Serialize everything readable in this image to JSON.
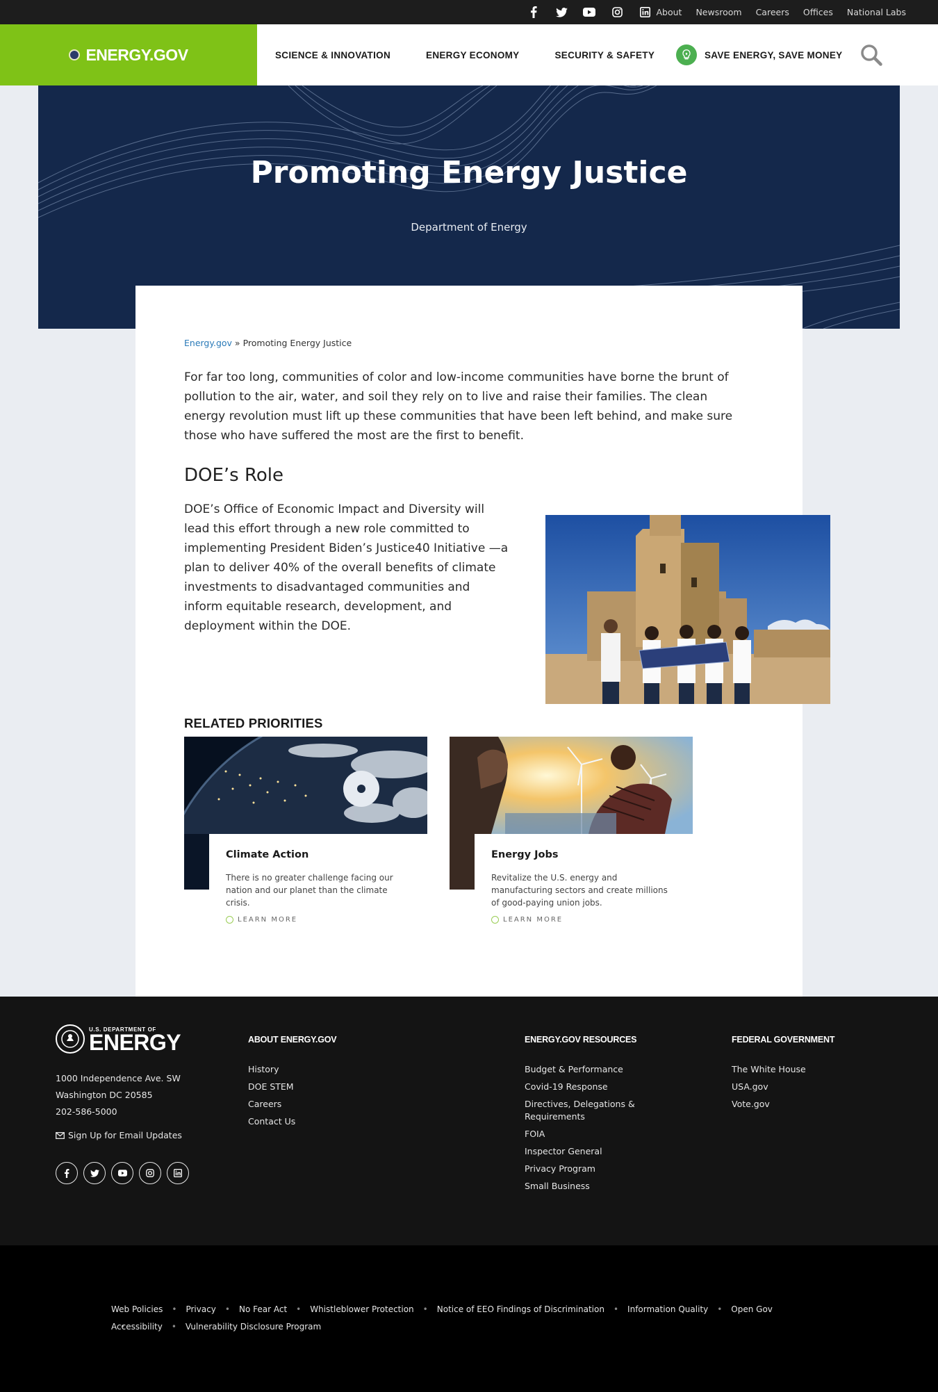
{
  "utility": {
    "social_icons": [
      "facebook-icon",
      "twitter-icon",
      "youtube-icon",
      "instagram-icon",
      "linkedin-icon"
    ],
    "links": [
      "About",
      "Newsroom",
      "Careers",
      "Offices",
      "National Labs"
    ]
  },
  "header": {
    "logo": "ENERGY.GOV",
    "nav": [
      "SCIENCE & INNOVATION",
      "ENERGY ECONOMY",
      "SECURITY & SAFETY"
    ],
    "save_energy": "SAVE ENERGY, SAVE MONEY",
    "search_icon": "search-icon",
    "brand_color": "#7fc217"
  },
  "hero": {
    "title": "Promoting Energy Justice",
    "subtitle": "Department of Energy",
    "background_color": "#14284b"
  },
  "main": {
    "breadcrumb": {
      "home": "Energy.gov",
      "separator": "»",
      "current": "Promoting Energy Justice"
    },
    "intro": "For far too long, communities of color and low-income communities have borne the brunt of pollution to the air, water, and soil they rely on to live and raise their families. The clean energy revolution must lift up these communities that have been left behind, and make sure those who have suffered the most are the first to benefit.",
    "role_heading": "DOE’s Role",
    "role_text": "DOE’s Office of Economic Impact and Diversity will lead this effort through a new role committed to  implementing President Biden’s Justice40 Initiative —a plan to deliver 40% of the overall benefits of climate investments to disadvantaged communities and inform equitable research, development, and deployment  within the DOE.",
    "related_heading": "RELATED PRIORITIES",
    "priorities": [
      {
        "title": "Climate Action",
        "text": "There is no greater challenge facing our nation and our planet than the climate crisis.",
        "link": "LEARN MORE"
      },
      {
        "title": "Energy Jobs",
        "text": "Revitalize the U.S. energy and manufacturing sectors and create millions of good-paying union jobs.",
        "link": "LEARN MORE"
      }
    ]
  },
  "footer": {
    "logo_small": "U.S. DEPARTMENT OF",
    "logo_big": "ENERGY",
    "address": [
      "1000 Independence Ave. SW",
      "Washington DC 20585",
      "202-586-5000"
    ],
    "email_signup": "Sign Up for Email Updates",
    "columns": [
      {
        "heading": "ABOUT ENERGY.GOV",
        "links": [
          "History",
          "DOE STEM",
          "Careers",
          "Contact Us"
        ]
      },
      {
        "heading": "ENERGY.GOV RESOURCES",
        "links": [
          "Budget & Performance",
          "Covid-19 Response",
          "Directives, Delegations & Requirements",
          "FOIA",
          "Inspector General",
          "Privacy Program",
          "Small Business"
        ]
      },
      {
        "heading": "FEDERAL GOVERNMENT",
        "links": [
          "The White House",
          "USA.gov",
          "Vote.gov"
        ]
      }
    ]
  },
  "legal": {
    "row1": [
      "Web Policies",
      "Privacy",
      "No Fear Act",
      "Whistleblower Protection",
      "Notice of EEO Findings of Discrimination",
      "Information Quality",
      "Open Gov"
    ],
    "row2": [
      "Accessibility",
      "Vulnerability Disclosure Program"
    ]
  }
}
